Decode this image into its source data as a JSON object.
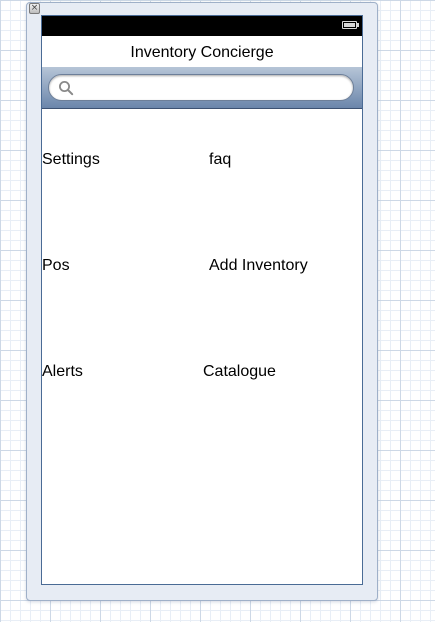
{
  "window": {
    "close_glyph": "×"
  },
  "nav": {
    "title": "Inventory Concierge"
  },
  "search": {
    "placeholder": "",
    "value": ""
  },
  "menu": {
    "settings": "Settings",
    "faq": "faq",
    "pos": "Pos",
    "add_inventory": "Add Inventory",
    "alerts": "Alerts",
    "catalogue": "Catalogue"
  },
  "colors": {
    "device_border": "#4a6b95",
    "search_bar_top": "#b6c5d7",
    "search_bar_bottom": "#6b86ab",
    "status_bar": "#000000"
  }
}
